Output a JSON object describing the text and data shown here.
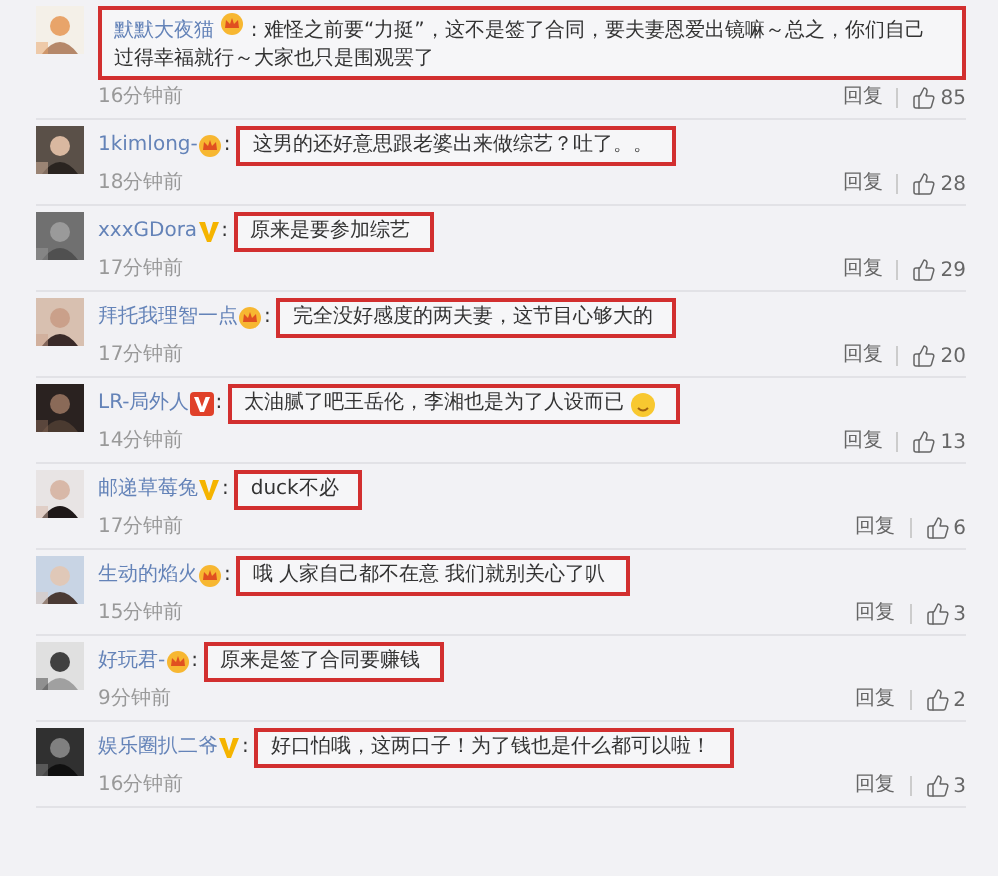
{
  "comments": [
    {
      "name": "默默大夜猫",
      "kind": "crown",
      "separator": ":",
      "text": "难怪之前要“力挺”，这不是签了合同，要夫妻恩爱出镜嘛～总之，你们自己过得幸福就行～大家也只是围观罢了",
      "box_includes_name": true,
      "emoji": false,
      "time": "16分钟前",
      "reply": "回复",
      "likes": "85"
    },
    {
      "name": "1kimlong-",
      "kind": "crown",
      "separator": ":",
      "text": "这男的还好意思跟老婆出来做综艺？吐了。。",
      "box_includes_name": false,
      "emoji": false,
      "time": "18分钟前",
      "reply": "回复",
      "likes": "28"
    },
    {
      "name": "xxxGDora",
      "kind": "v_gold",
      "separator": ":",
      "text": "原来是要参加综艺",
      "box_includes_name": false,
      "emoji": false,
      "time": "17分钟前",
      "reply": "回复",
      "likes": "29"
    },
    {
      "name": "拜托我理智一点",
      "kind": "crown",
      "separator": ":",
      "text": "完全没好感度的两夫妻，这节目心够大的",
      "box_includes_name": false,
      "emoji": false,
      "time": "17分钟前",
      "reply": "回复",
      "likes": "20"
    },
    {
      "name": "LR-局外人",
      "kind": "v_red",
      "separator": ":",
      "text": "太油腻了吧王岳伦，李湘也是为了人设而已",
      "box_includes_name": false,
      "emoji": true,
      "time": "14分钟前",
      "reply": "回复",
      "likes": "13"
    },
    {
      "name": "邮递草莓兔",
      "kind": "v_gold",
      "separator": ":",
      "text": "duck不必",
      "box_includes_name": false,
      "emoji": false,
      "time": "17分钟前",
      "reply": "回复",
      "likes": "6"
    },
    {
      "name": "生动的焰火",
      "kind": "crown",
      "separator": ":",
      "text": "哦 人家自己都不在意 我们就别关心了叭",
      "box_includes_name": false,
      "emoji": false,
      "time": "15分钟前",
      "reply": "回复",
      "likes": "3"
    },
    {
      "name": "好玩君-",
      "kind": "crown",
      "separator": ":",
      "text": "原来是签了合同要赚钱",
      "box_includes_name": false,
      "emoji": false,
      "time": "9分钟前",
      "reply": "回复",
      "likes": "2"
    },
    {
      "name": "娱乐圈扒二爷",
      "kind": "v_gold",
      "separator": ":",
      "text": "好口怕哦，这两口子！为了钱也是什么都可以啦！",
      "box_includes_name": false,
      "emoji": false,
      "time": "16分钟前",
      "reply": "回复",
      "likes": "3"
    }
  ]
}
